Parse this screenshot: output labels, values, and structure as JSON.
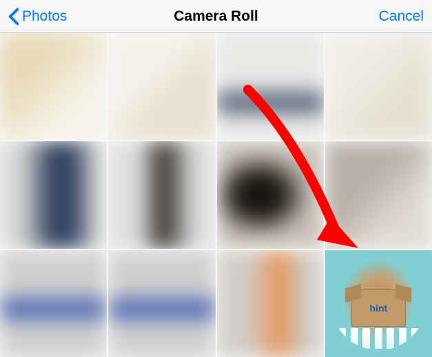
{
  "nav": {
    "back_label": "Photos",
    "title": "Camera Roll",
    "cancel_label": "Cancel"
  },
  "highlighted_thumb": {
    "brand_text": "hint"
  }
}
